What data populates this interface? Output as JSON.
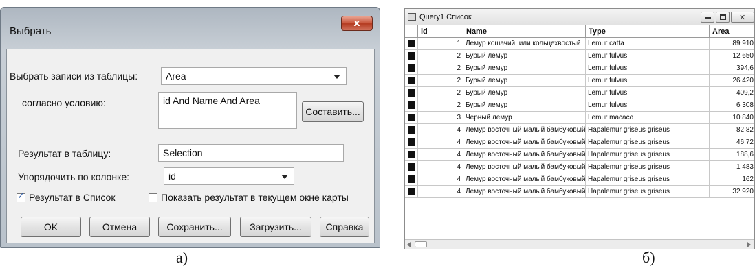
{
  "dialog": {
    "title": "Выбрать",
    "close_symbol": "x",
    "select_from_label": "Выбрать записи из таблицы:",
    "select_from_value": "Area",
    "condition_label": "согласно условию:",
    "condition_value": "id And Name And Area",
    "compose_button": "Составить...",
    "result_table_label": "Результат в таблицу:",
    "result_table_value": "Selection",
    "order_by_label": "Упорядочить по колонке:",
    "order_by_value": "id",
    "result_in_list_label": "Результат в Список",
    "result_in_list_checked": true,
    "show_in_map_label": "Показать результат в текущем окне карты",
    "show_in_map_checked": false,
    "buttons": {
      "ok": "OK",
      "cancel": "Отмена",
      "save": "Сохранить...",
      "load": "Загрузить...",
      "help": "Справка"
    }
  },
  "list_window": {
    "title": "Query1 Список",
    "columns": [
      "id",
      "Name",
      "Type",
      "Area"
    ],
    "rows": [
      [
        "1",
        "Лемур кошачий, или кольцехвостый",
        "Lemur catta",
        "89 910"
      ],
      [
        "2",
        "Бурый лемур",
        "Lemur fulvus",
        "12 650"
      ],
      [
        "2",
        "Бурый лемур",
        "Lemur fulvus",
        "394,6"
      ],
      [
        "2",
        "Бурый лемур",
        "Lemur fulvus",
        "26 420"
      ],
      [
        "2",
        "Бурый лемур",
        "Lemur fulvus",
        "409,2"
      ],
      [
        "2",
        "Бурый лемур",
        "Lemur fulvus",
        "6 308"
      ],
      [
        "3",
        "Черный лемур",
        "Lemur macaco",
        "10 840"
      ],
      [
        "4",
        "Лемур восточный малый бамбуковый",
        "Hapalemur griseus griseus",
        "82,82"
      ],
      [
        "4",
        "Лемур восточный малый бамбуковый",
        "Hapalemur griseus griseus",
        "46,72"
      ],
      [
        "4",
        "Лемур восточный малый бамбуковый",
        "Hapalemur griseus griseus",
        "188,6"
      ],
      [
        "4",
        "Лемур восточный малый бамбуковый",
        "Hapalemur griseus griseus",
        "1 483"
      ],
      [
        "4",
        "Лемур восточный малый бамбуковый",
        "Hapalemur griseus griseus",
        "162"
      ],
      [
        "4",
        "Лемур восточный малый бамбуковый",
        "Hapalemur griseus griseus",
        "32 920"
      ]
    ]
  },
  "captions": {
    "left": "а)",
    "right": "б)"
  }
}
